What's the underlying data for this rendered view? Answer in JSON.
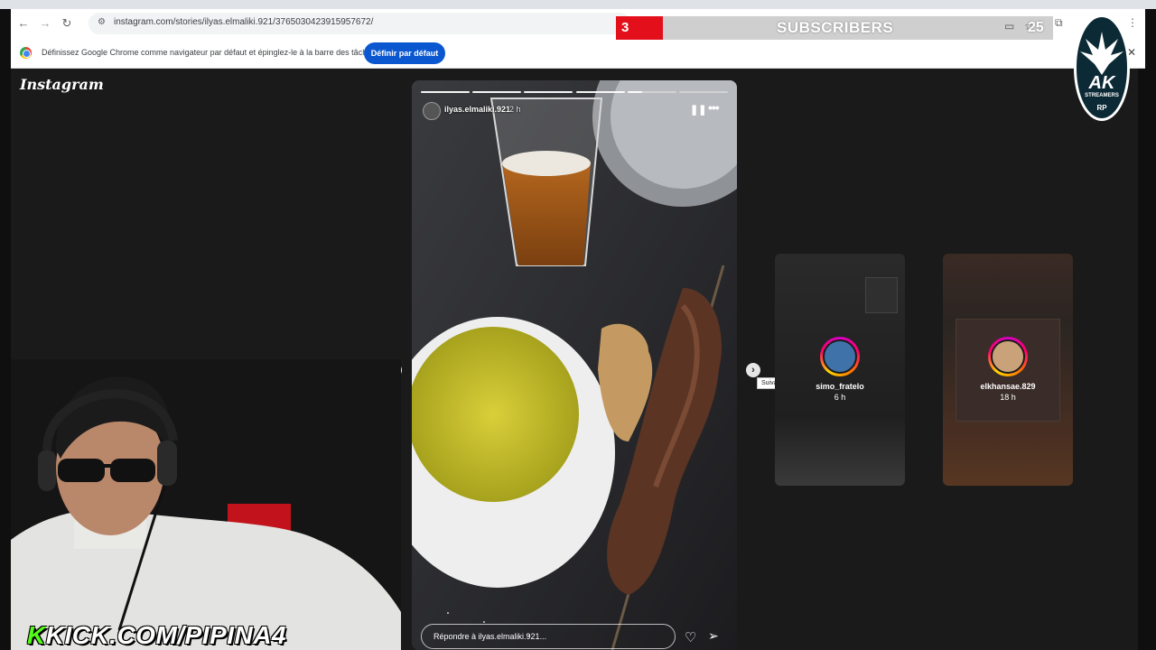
{
  "browser": {
    "url": "instagram.com/stories/ilyas.elmaliki.921/3765030423915957672/",
    "infobar_text": "Définissez Google Chrome comme navigateur par défaut et épinglez-le à la barre des tâches",
    "infobar_button": "Définir par défaut",
    "icons": [
      "back-icon",
      "forward-icon",
      "reload-icon",
      "site-info-icon",
      "close-icon"
    ]
  },
  "overlay": {
    "subscriber_count": "3",
    "subscriber_label": "SUBSCRIBERS",
    "subscriber_goal": "25",
    "badge_letters": "AK",
    "badge_sub": "STREAMERS",
    "badge_rp": "RP",
    "kick_prefix": "K",
    "kick_text": "KICK.COM/PIPINA4"
  },
  "instagram": {
    "logo": "Instagram",
    "story": {
      "username": "ilyas.elmaliki.921",
      "time": "2 h",
      "reply_placeholder": "Répondre à ilyas.elmaliki.921...",
      "progress_segments": 6,
      "progress_active_index": 4,
      "progress_active_fraction": 0.3
    },
    "next_tooltip": "Suivant",
    "side_stories": [
      {
        "username": "simo_fratelo",
        "time": "6 h"
      },
      {
        "username": "elkhansae.829",
        "time": "18 h"
      }
    ]
  },
  "colors": {
    "subscriber_red": "#e3101c",
    "chrome_blue_button": "#0b57d0",
    "kick_green": "#53fc18",
    "story_ring": "#ff0069"
  }
}
